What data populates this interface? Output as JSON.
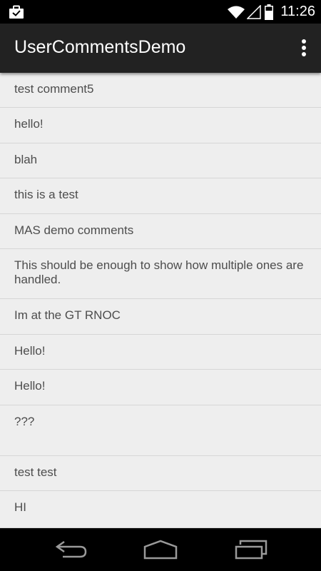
{
  "status_bar": {
    "time": "11:26",
    "icons": [
      "notification-briefcase-icon",
      "wifi-icon",
      "signal-icon",
      "battery-icon"
    ]
  },
  "app_bar": {
    "title": "UserCommentsDemo",
    "overflow_icon": "more-vert-icon"
  },
  "comments": [
    "test comment5",
    "hello!",
    "blah",
    "this is a test",
    "MAS demo comments",
    "This should be enough to show how multiple ones are handled.",
    "Im at the GT RNOC",
    "Hello!",
    "Hello!",
    "???",
    "test test",
    "HI"
  ],
  "nav_bar": {
    "icons": [
      "back-icon",
      "home-icon",
      "recents-icon"
    ]
  },
  "colors": {
    "status_bar": "#000000",
    "app_bar": "#222222",
    "list_background": "#eeeeee",
    "divider": "#d6d6d6",
    "text": "#4d4d4d",
    "nav_bar": "#000000"
  }
}
